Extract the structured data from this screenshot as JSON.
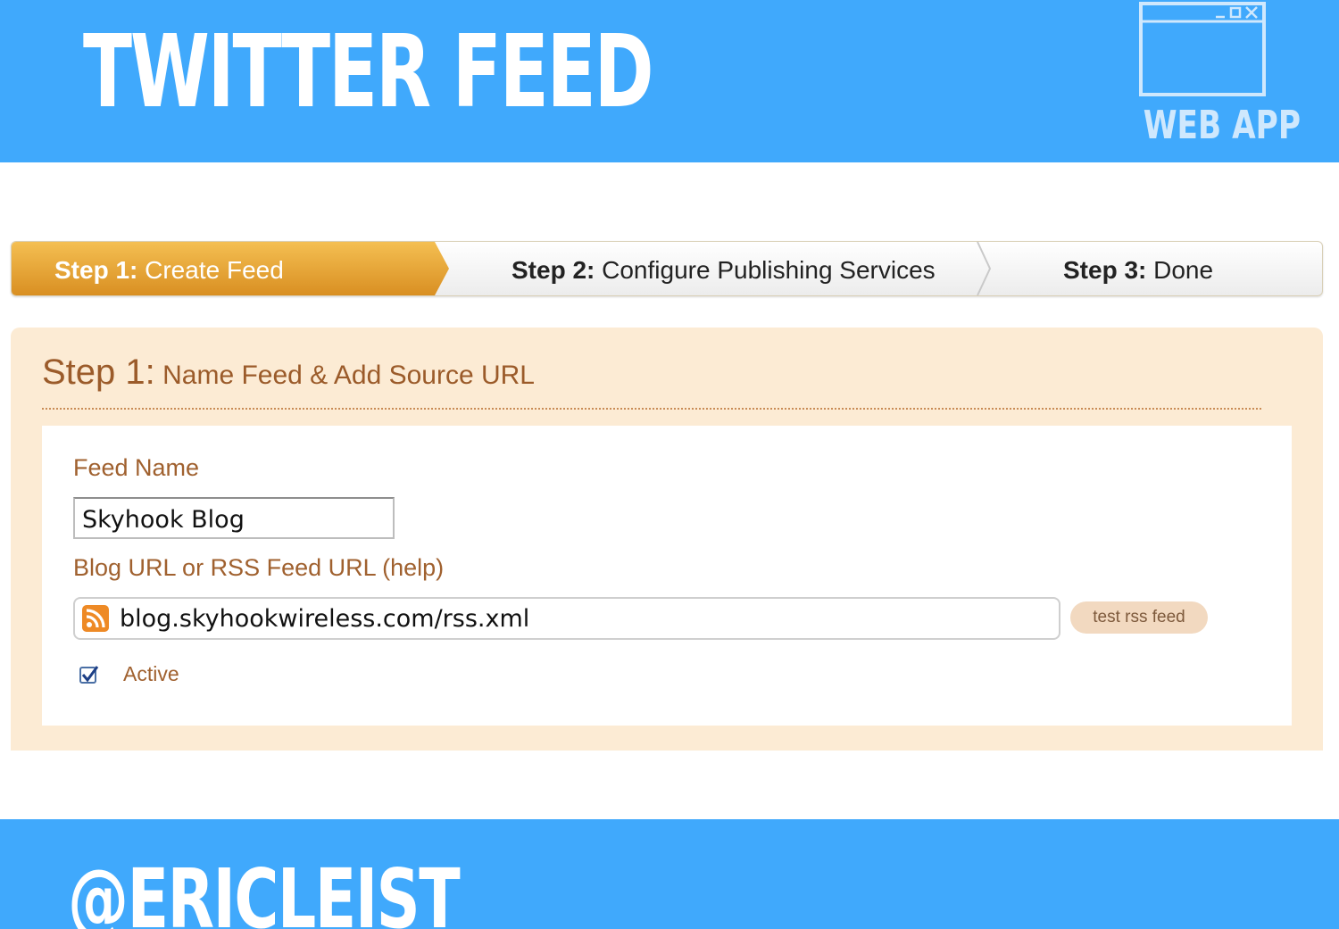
{
  "slide": {
    "title": "TWITTER FEED",
    "badge_label": "WEB APP",
    "handle": "@ERICLEIST",
    "colors": {
      "banner": "#40a9fc",
      "panel": "#fcebd4",
      "step_active": "#e8a73a",
      "label": "#a0612f"
    }
  },
  "steps": [
    {
      "prefix": "Step 1:",
      "label": "Create Feed",
      "active": true
    },
    {
      "prefix": "Step 2:",
      "label": "Configure Publishing Services",
      "active": false
    },
    {
      "prefix": "Step 3:",
      "label": "Done",
      "active": false
    }
  ],
  "panel": {
    "heading_prefix": "Step 1:",
    "heading_text": "Name Feed & Add Source URL",
    "feed_name_label": "Feed Name",
    "feed_name_value": "Skyhook Blog",
    "url_label": "Blog URL or RSS Feed URL (help)",
    "url_value": "blog.skyhookwireless.com/rss.xml",
    "url_icon": "rss-icon",
    "test_button_label": "test rss feed",
    "active_label": "Active",
    "active_checked": true
  }
}
